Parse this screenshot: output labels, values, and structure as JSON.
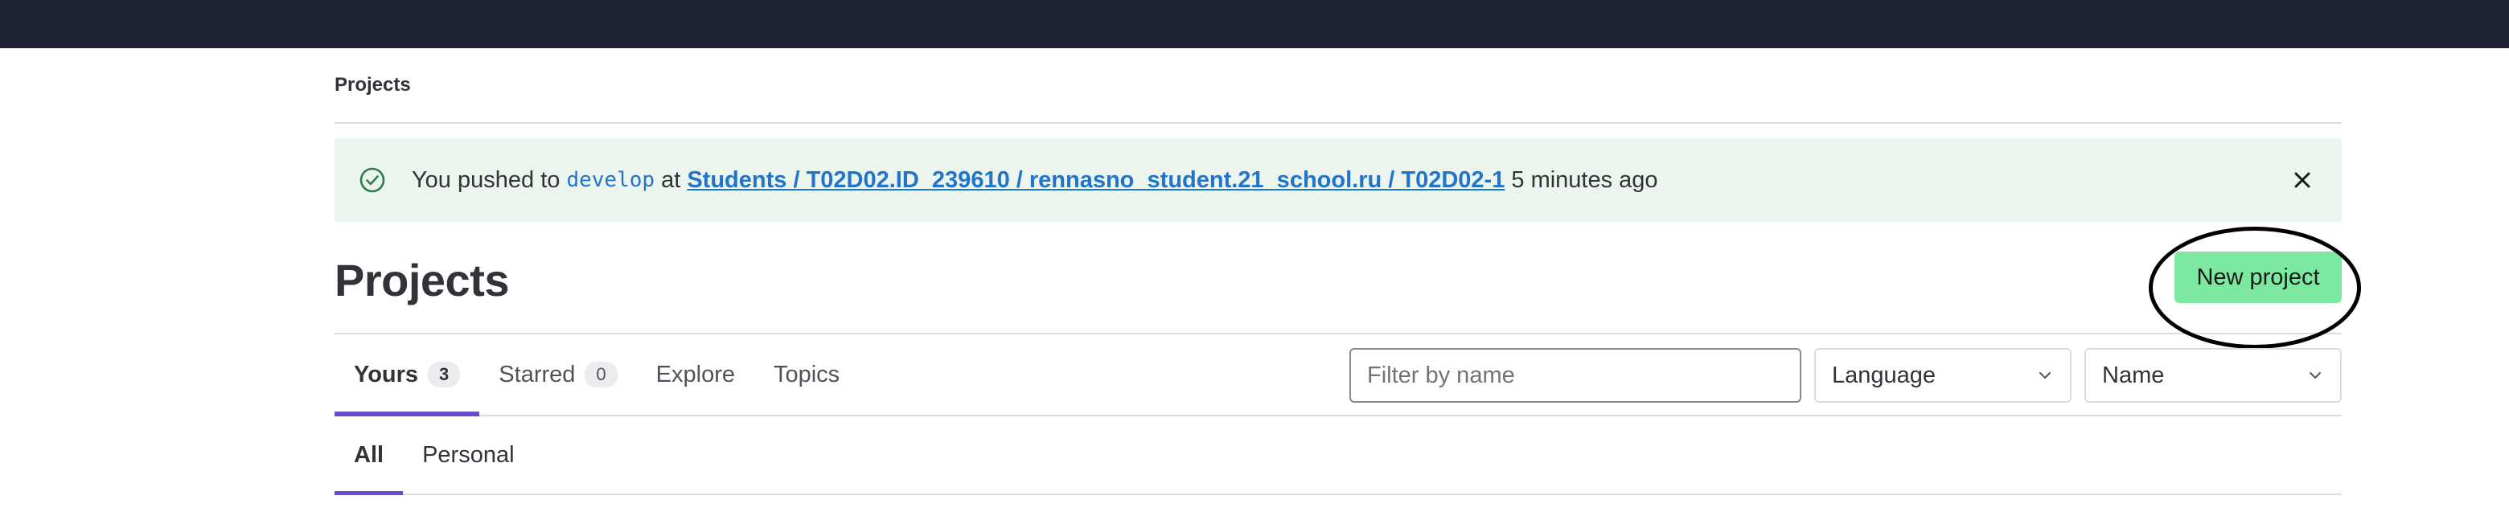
{
  "breadcrumb": {
    "current": "Projects"
  },
  "alert": {
    "prefix": "You pushed to",
    "branch": "develop",
    "at": "at",
    "link": "Students / T02D02.ID_239610 / rennasno_student.21_school.ru / T02D02-1",
    "suffix": "5 minutes ago",
    "icon": "check-circle-icon",
    "close_icon": "close-icon"
  },
  "header": {
    "title": "Projects",
    "new_project_label": "New project"
  },
  "tabs": [
    {
      "label": "Yours",
      "count": "3",
      "active": true
    },
    {
      "label": "Starred",
      "count": "0",
      "active": false
    },
    {
      "label": "Explore",
      "active": false
    },
    {
      "label": "Topics",
      "active": false
    }
  ],
  "filters": {
    "search_placeholder": "Filter by name",
    "language_label": "Language",
    "sort_label": "Name"
  },
  "subtabs": [
    {
      "label": "All",
      "active": true
    },
    {
      "label": "Personal",
      "active": false
    }
  ],
  "colors": {
    "topbar": "#1f2433",
    "alert_bg": "#ecf4ee",
    "accent": "#6e49cb",
    "new_project_bg": "#7ce8a0",
    "link": "#1f75cb"
  }
}
